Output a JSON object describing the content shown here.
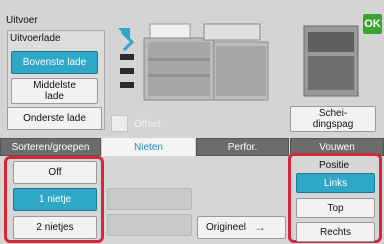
{
  "screen": {
    "title": "Uitvoer",
    "ok_label": "OK",
    "accent_color": "#2fa7c7",
    "highlight_color": "#d02a3a"
  },
  "output_tray": {
    "label": "Uitvoerlade",
    "options": [
      {
        "label": "Bovenste lade",
        "selected": true
      },
      {
        "label": "Middelste lade",
        "selected": false
      },
      {
        "label": "Onderste lade",
        "selected": false
      }
    ]
  },
  "offset": {
    "label": "Offset",
    "checked": false,
    "enabled": false
  },
  "separator_button": {
    "label": "Schei-dingspag"
  },
  "tabs": [
    {
      "label": "Sorteren/groepen",
      "active": false
    },
    {
      "label": "Nieten",
      "active": true
    },
    {
      "label": "Perfor.",
      "active": false
    },
    {
      "label": "Vouwen",
      "active": false
    }
  ],
  "staple": {
    "options": [
      {
        "label": "Off",
        "selected": false
      },
      {
        "label": "1 nietje",
        "selected": true
      },
      {
        "label": "2 nietjes",
        "selected": false
      }
    ]
  },
  "original_button": {
    "label": "Origineel"
  },
  "position": {
    "label": "Positie",
    "options": [
      {
        "label": "Links",
        "selected": true
      },
      {
        "label": "Top",
        "selected": false
      },
      {
        "label": "Rechts",
        "selected": false
      }
    ]
  }
}
